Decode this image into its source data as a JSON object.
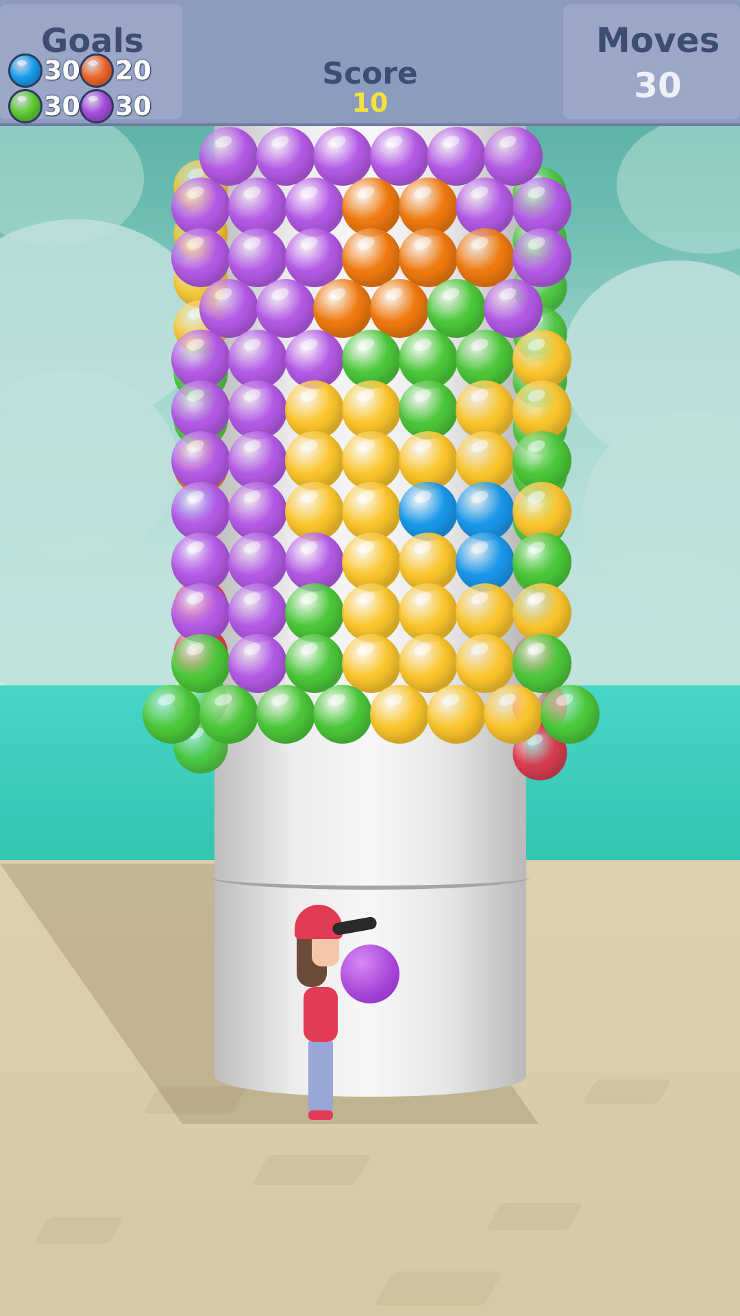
{
  "hud": {
    "goals_title": "Goals",
    "score_title": "Score",
    "score_value": "10",
    "moves_title": "Moves",
    "moves_value": "30",
    "goals": [
      {
        "color_name": "blue",
        "color": "#1a9ff0",
        "count": "30"
      },
      {
        "color_name": "orange",
        "color": "#f2682a",
        "count": "20"
      },
      {
        "color_name": "green",
        "color": "#5fce34",
        "count": "30"
      },
      {
        "color_name": "purple",
        "color": "#a94ee0",
        "count": "30"
      }
    ]
  },
  "colors": {
    "P": "#b45ae6",
    "O": "#f07a10",
    "G": "#4cc83a",
    "Y": "#fbc52c",
    "B": "#1a98ea",
    "R": "#e53047"
  },
  "tower": {
    "front_rows": [
      "PPPPPP",
      "PPPOOPP",
      "PPPOOOP",
      "PPOOGP",
      "PPPGGGY",
      "PPYYGYY",
      "PPYYYYG",
      "PPYYBBY",
      "PPPYYBG",
      "PPGYYYY",
      "GPGYYYG",
      "GGGGYYYG"
    ],
    "left_back": [
      "Y",
      "Y",
      "Y",
      "Y",
      "G",
      "G",
      "O",
      "B",
      "P",
      "R",
      "R",
      "G",
      "G"
    ],
    "right_back": [
      "G",
      "G",
      "G",
      "G",
      "G",
      "G",
      "G",
      "G",
      "G",
      "B",
      "R",
      "R",
      "R"
    ]
  },
  "character": {
    "held_ball_color": "purple"
  }
}
